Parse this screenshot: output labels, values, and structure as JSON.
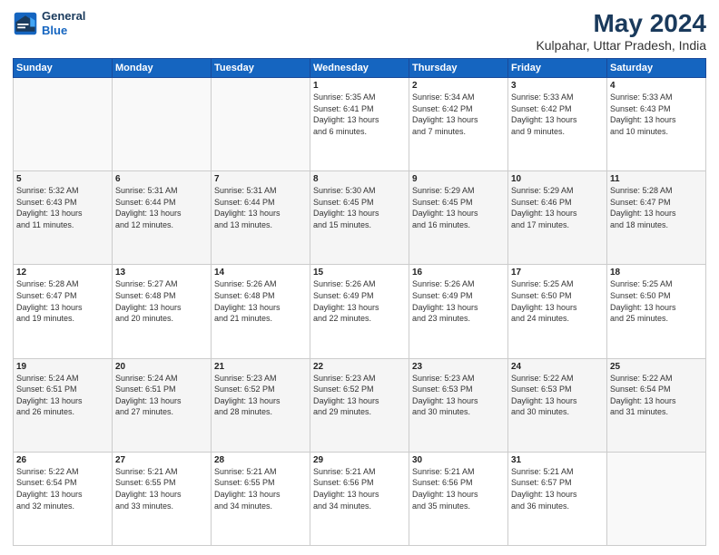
{
  "logo": {
    "line1": "General",
    "line2": "Blue"
  },
  "title": "May 2024",
  "subtitle": "Kulpahar, Uttar Pradesh, India",
  "days_of_week": [
    "Sunday",
    "Monday",
    "Tuesday",
    "Wednesday",
    "Thursday",
    "Friday",
    "Saturday"
  ],
  "weeks": [
    [
      {
        "day": "",
        "info": ""
      },
      {
        "day": "",
        "info": ""
      },
      {
        "day": "",
        "info": ""
      },
      {
        "day": "1",
        "info": "Sunrise: 5:35 AM\nSunset: 6:41 PM\nDaylight: 13 hours\nand 6 minutes."
      },
      {
        "day": "2",
        "info": "Sunrise: 5:34 AM\nSunset: 6:42 PM\nDaylight: 13 hours\nand 7 minutes."
      },
      {
        "day": "3",
        "info": "Sunrise: 5:33 AM\nSunset: 6:42 PM\nDaylight: 13 hours\nand 9 minutes."
      },
      {
        "day": "4",
        "info": "Sunrise: 5:33 AM\nSunset: 6:43 PM\nDaylight: 13 hours\nand 10 minutes."
      }
    ],
    [
      {
        "day": "5",
        "info": "Sunrise: 5:32 AM\nSunset: 6:43 PM\nDaylight: 13 hours\nand 11 minutes."
      },
      {
        "day": "6",
        "info": "Sunrise: 5:31 AM\nSunset: 6:44 PM\nDaylight: 13 hours\nand 12 minutes."
      },
      {
        "day": "7",
        "info": "Sunrise: 5:31 AM\nSunset: 6:44 PM\nDaylight: 13 hours\nand 13 minutes."
      },
      {
        "day": "8",
        "info": "Sunrise: 5:30 AM\nSunset: 6:45 PM\nDaylight: 13 hours\nand 15 minutes."
      },
      {
        "day": "9",
        "info": "Sunrise: 5:29 AM\nSunset: 6:45 PM\nDaylight: 13 hours\nand 16 minutes."
      },
      {
        "day": "10",
        "info": "Sunrise: 5:29 AM\nSunset: 6:46 PM\nDaylight: 13 hours\nand 17 minutes."
      },
      {
        "day": "11",
        "info": "Sunrise: 5:28 AM\nSunset: 6:47 PM\nDaylight: 13 hours\nand 18 minutes."
      }
    ],
    [
      {
        "day": "12",
        "info": "Sunrise: 5:28 AM\nSunset: 6:47 PM\nDaylight: 13 hours\nand 19 minutes."
      },
      {
        "day": "13",
        "info": "Sunrise: 5:27 AM\nSunset: 6:48 PM\nDaylight: 13 hours\nand 20 minutes."
      },
      {
        "day": "14",
        "info": "Sunrise: 5:26 AM\nSunset: 6:48 PM\nDaylight: 13 hours\nand 21 minutes."
      },
      {
        "day": "15",
        "info": "Sunrise: 5:26 AM\nSunset: 6:49 PM\nDaylight: 13 hours\nand 22 minutes."
      },
      {
        "day": "16",
        "info": "Sunrise: 5:26 AM\nSunset: 6:49 PM\nDaylight: 13 hours\nand 23 minutes."
      },
      {
        "day": "17",
        "info": "Sunrise: 5:25 AM\nSunset: 6:50 PM\nDaylight: 13 hours\nand 24 minutes."
      },
      {
        "day": "18",
        "info": "Sunrise: 5:25 AM\nSunset: 6:50 PM\nDaylight: 13 hours\nand 25 minutes."
      }
    ],
    [
      {
        "day": "19",
        "info": "Sunrise: 5:24 AM\nSunset: 6:51 PM\nDaylight: 13 hours\nand 26 minutes."
      },
      {
        "day": "20",
        "info": "Sunrise: 5:24 AM\nSunset: 6:51 PM\nDaylight: 13 hours\nand 27 minutes."
      },
      {
        "day": "21",
        "info": "Sunrise: 5:23 AM\nSunset: 6:52 PM\nDaylight: 13 hours\nand 28 minutes."
      },
      {
        "day": "22",
        "info": "Sunrise: 5:23 AM\nSunset: 6:52 PM\nDaylight: 13 hours\nand 29 minutes."
      },
      {
        "day": "23",
        "info": "Sunrise: 5:23 AM\nSunset: 6:53 PM\nDaylight: 13 hours\nand 30 minutes."
      },
      {
        "day": "24",
        "info": "Sunrise: 5:22 AM\nSunset: 6:53 PM\nDaylight: 13 hours\nand 30 minutes."
      },
      {
        "day": "25",
        "info": "Sunrise: 5:22 AM\nSunset: 6:54 PM\nDaylight: 13 hours\nand 31 minutes."
      }
    ],
    [
      {
        "day": "26",
        "info": "Sunrise: 5:22 AM\nSunset: 6:54 PM\nDaylight: 13 hours\nand 32 minutes."
      },
      {
        "day": "27",
        "info": "Sunrise: 5:21 AM\nSunset: 6:55 PM\nDaylight: 13 hours\nand 33 minutes."
      },
      {
        "day": "28",
        "info": "Sunrise: 5:21 AM\nSunset: 6:55 PM\nDaylight: 13 hours\nand 34 minutes."
      },
      {
        "day": "29",
        "info": "Sunrise: 5:21 AM\nSunset: 6:56 PM\nDaylight: 13 hours\nand 34 minutes."
      },
      {
        "day": "30",
        "info": "Sunrise: 5:21 AM\nSunset: 6:56 PM\nDaylight: 13 hours\nand 35 minutes."
      },
      {
        "day": "31",
        "info": "Sunrise: 5:21 AM\nSunset: 6:57 PM\nDaylight: 13 hours\nand 36 minutes."
      },
      {
        "day": "",
        "info": ""
      }
    ]
  ]
}
